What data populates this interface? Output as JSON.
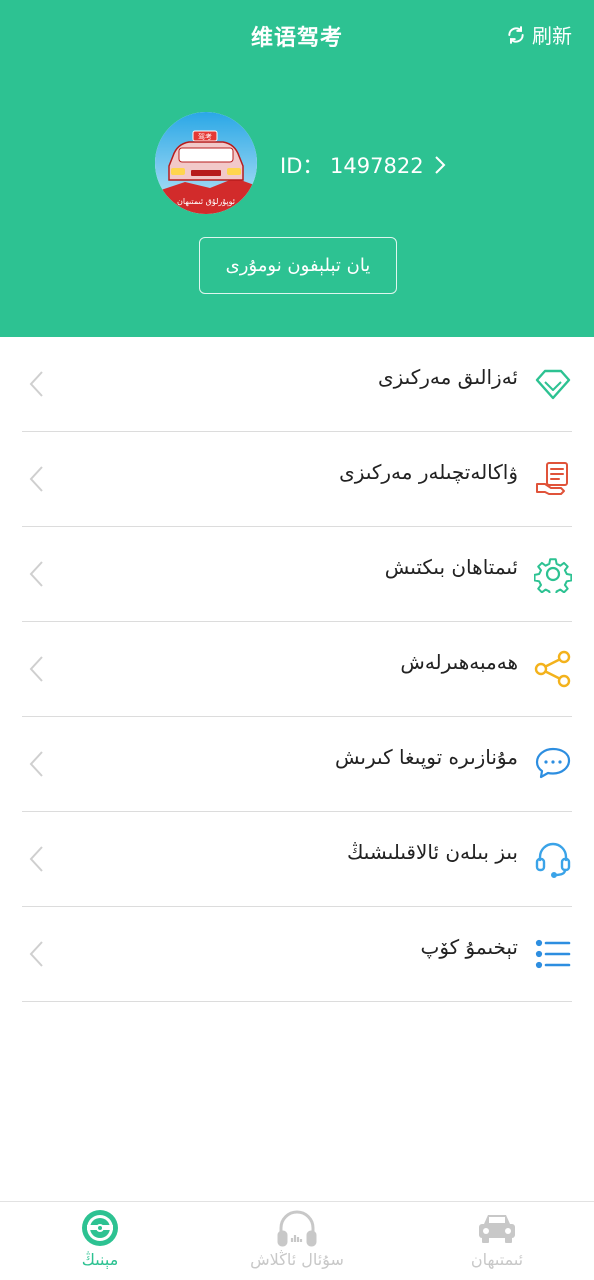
{
  "header": {
    "title": "维语驾考",
    "refresh_label": "刷新",
    "user_id": "ID：  1497822",
    "phone_button": "يان تېلېفون نومۇرى",
    "avatar_banner": "ئوپۇرلۇق ئىمتىھان",
    "avatar_sign": "驾考",
    "accent_color": "#2dc292"
  },
  "menu": {
    "items": [
      {
        "label": "ئەزالىق مەركىزى",
        "icon": "diamond-icon",
        "icon_color": "#2dc292"
      },
      {
        "label": "ۋاكالەتچىلەر مەركىزى",
        "icon": "document-hand-icon",
        "icon_color": "#e0533a"
      },
      {
        "label": "ئىمتاھان بىكتىش",
        "icon": "gear-icon",
        "icon_color": "#2dc292"
      },
      {
        "label": "ھەمبەھىرلەش",
        "icon": "share-icon",
        "icon_color": "#f3b21c"
      },
      {
        "label": "مۇنازىرە توپىغا كىرىش",
        "icon": "chat-icon",
        "icon_color": "#2d8ee0"
      },
      {
        "label": "بىز بىلەن ئالاقىلىشىڭ",
        "icon": "headset-icon",
        "icon_color": "#3aa3e8"
      },
      {
        "label": "تېخىمۇ كۆپ",
        "icon": "list-icon",
        "icon_color": "#2d8ee0"
      }
    ]
  },
  "tabbar": {
    "tabs": [
      {
        "label": "مېنىڭ",
        "icon": "steering-wheel-icon",
        "active": true
      },
      {
        "label": "سۇئال ئاڭلاش",
        "icon": "headphones-icon",
        "active": false
      },
      {
        "label": "ئىمتىھان",
        "icon": "car-icon",
        "active": false
      }
    ]
  }
}
